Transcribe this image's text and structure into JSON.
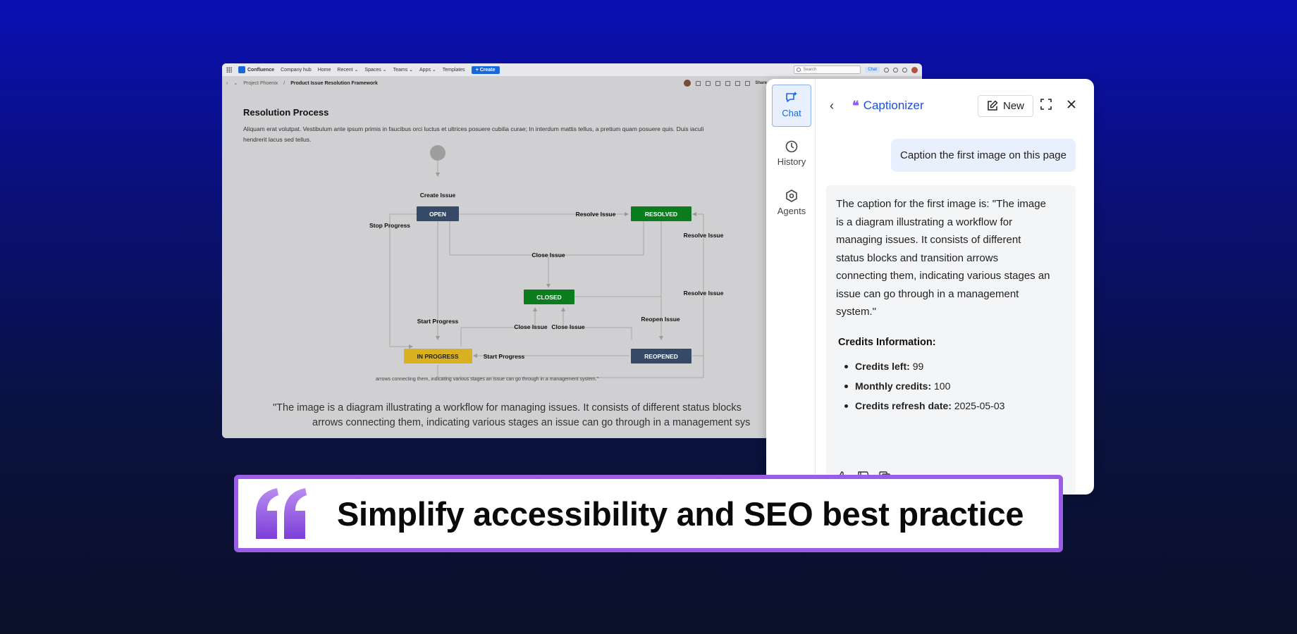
{
  "confluence": {
    "app_name": "Confluence",
    "nav": [
      "Company hub",
      "Home",
      "Recent ⌄",
      "Spaces ⌄",
      "Teams ⌄",
      "Apps ⌄",
      "Templates"
    ],
    "create_label": "+ Create",
    "search_placeholder": "Search",
    "chat_label": "Chat",
    "breadcrumb": {
      "space": "Project Phoenix",
      "separator": "/",
      "page": "Product Issue Resolution Framework"
    },
    "share_label": "Share",
    "heading": "Resolution Process",
    "paragraph_line1": "Aliquam erat volutpat. Vestibulum ante ipsum primis in faucibus orci luctus et ultrices posuere cubilia curae; In interdum mattis tellus, a pretium quam posuere quis. Duis iaculi",
    "paragraph_line2": "hendrerit lacus sed tellus.",
    "caption_small": "arrows connecting them, indicating various stages an issue can go through in a management system.\"",
    "quote_line1": "\"The image is a diagram illustrating a workflow for managing issues. It consists of different status blocks",
    "quote_line2": "arrows connecting them, indicating various stages an issue can go through in a management sys"
  },
  "diagram": {
    "nodes": {
      "open": "OPEN",
      "resolved": "RESOLVED",
      "closed": "CLOSED",
      "in_progress": "IN PROGRESS",
      "reopened": "REOPENED"
    },
    "labels": {
      "create_issue": "Create Issue",
      "resolve_issue_1": "Resolve Issue",
      "stop_progress": "Stop Progress",
      "resolve_issue_2": "Resolve Issue",
      "close_issue_1": "Close Issue",
      "resolve_issue_3": "Resolve Issue",
      "start_progress_1": "Start Progress",
      "reopen_issue": "Reopen Issue",
      "close_issue_2": "Close Issue",
      "close_issue_3": "Close Issue",
      "start_progress_2": "Start Progress"
    },
    "colors": {
      "open": "#344a67",
      "resolved": "#0b7d1e",
      "closed": "#0b7d1e",
      "in_progress": "#d8b020",
      "reopened": "#344a67"
    }
  },
  "panel": {
    "rail": {
      "chat": "Chat",
      "history": "History",
      "agents": "Agents"
    },
    "brand": "Captionizer",
    "new_label": "New",
    "user_message": "Caption the first image on this page",
    "ai_lines": [
      "The caption for the first image is: \"The image",
      "is a diagram illustrating a workflow for",
      "managing issues. It consists of different",
      "status blocks and transition arrows",
      "connecting them, indicating various stages an",
      "issue can go through in a management",
      "system.\""
    ],
    "credits_title": "Credits Information:",
    "credits": [
      {
        "label": "Credits left:",
        "value": "99"
      },
      {
        "label": "Monthly credits:",
        "value": "100"
      },
      {
        "label": "Credits refresh date:",
        "value": "2025-05-03"
      }
    ]
  },
  "banner": {
    "text": "Simplify accessibility and SEO best practice",
    "accent_color": "#9b5de5"
  }
}
